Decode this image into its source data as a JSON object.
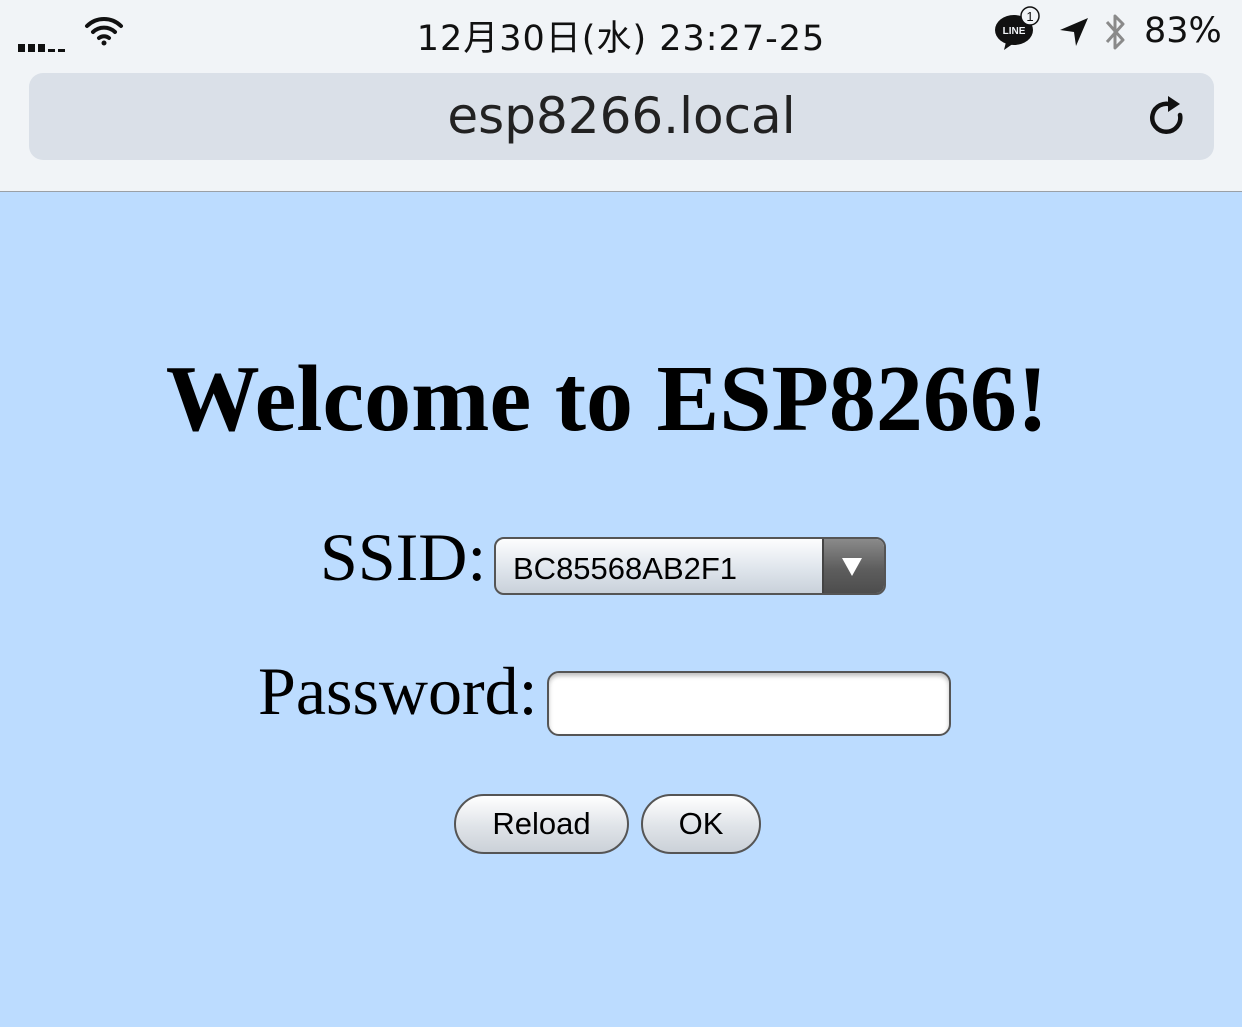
{
  "status_bar": {
    "time": "12月30日(水) 23:27-25",
    "battery": "83%",
    "line_badge_label": "LINE",
    "line_badge_count": "1"
  },
  "browser": {
    "url": "esp8266.local"
  },
  "page": {
    "heading": "Welcome to ESP8266!",
    "ssid_label": "SSID:",
    "ssid_selected": "BC85568AB2F1",
    "password_label": "Password:",
    "password_value": "",
    "reload_button": "Reload",
    "ok_button": "OK"
  },
  "colors": {
    "page_background": "#bcdcff",
    "chrome_background": "#f1f4f7",
    "url_bar_background": "#dae0e8"
  }
}
